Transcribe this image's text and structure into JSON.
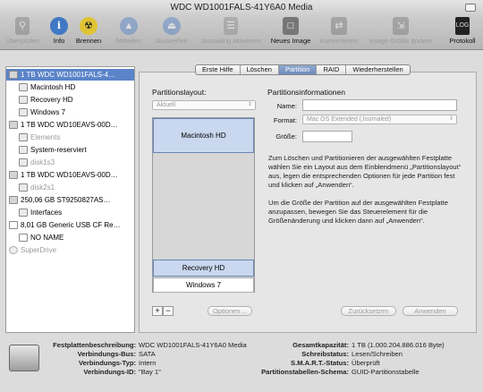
{
  "window": {
    "title": "WDC WD1001FALS-41Y6A0 Media"
  },
  "toolbar": {
    "items": [
      {
        "label": "Überprüfen",
        "icon": "microscope-icon",
        "enabled": false
      },
      {
        "label": "Info",
        "icon": "info-icon",
        "enabled": true
      },
      {
        "label": "Brennen",
        "icon": "burn-icon",
        "enabled": true
      },
      {
        "label": "Mitteilen",
        "icon": "mount-icon",
        "enabled": false
      },
      {
        "label": "Auswerfen",
        "icon": "eject-icon",
        "enabled": false
      },
      {
        "label": "Journaling aktivieren",
        "icon": "journal-icon",
        "enabled": false
      },
      {
        "label": "Neues Image",
        "icon": "new-image-icon",
        "enabled": true
      },
      {
        "label": "Konvertieren",
        "icon": "convert-icon",
        "enabled": false
      },
      {
        "label": "Image-Größe ändern",
        "icon": "resize-image-icon",
        "enabled": false
      },
      {
        "label": "Protokoll",
        "icon": "log-icon",
        "enabled": true
      }
    ]
  },
  "sidebar": {
    "items": [
      {
        "label": "1 TB WDC WD1001FALS-4…",
        "kind": "disk",
        "selected": true,
        "dimmed": false
      },
      {
        "label": "Macintosh HD",
        "kind": "volume",
        "selected": false,
        "dimmed": false
      },
      {
        "label": "Recovery HD",
        "kind": "volume",
        "selected": false,
        "dimmed": false
      },
      {
        "label": "Windows 7",
        "kind": "volume",
        "selected": false,
        "dimmed": false
      },
      {
        "label": "1 TB WDC WD10EAVS-00D…",
        "kind": "disk",
        "selected": false,
        "dimmed": false
      },
      {
        "label": "Elements",
        "kind": "volume",
        "selected": false,
        "dimmed": true
      },
      {
        "label": "System-reserviert",
        "kind": "volume",
        "selected": false,
        "dimmed": false
      },
      {
        "label": "disk1s3",
        "kind": "volume",
        "selected": false,
        "dimmed": true
      },
      {
        "label": "1 TB WDC WD10EAVS-00D…",
        "kind": "disk",
        "selected": false,
        "dimmed": false
      },
      {
        "label": "disk2s1",
        "kind": "volume",
        "selected": false,
        "dimmed": true
      },
      {
        "label": "250,06 GB ST9250827AS…",
        "kind": "disk",
        "selected": false,
        "dimmed": false
      },
      {
        "label": "Interfaces",
        "kind": "volume",
        "selected": false,
        "dimmed": false
      },
      {
        "label": "8,01 GB Generic USB CF Re…",
        "kind": "disk",
        "selected": false,
        "dimmed": false
      },
      {
        "label": "NO NAME",
        "kind": "volume",
        "selected": false,
        "dimmed": false
      },
      {
        "label": "SuperDrive",
        "kind": "optical",
        "selected": false,
        "dimmed": true
      }
    ]
  },
  "tabs": [
    {
      "label": "Erste Hilfe",
      "active": false
    },
    {
      "label": "Löschen",
      "active": false
    },
    {
      "label": "Partition",
      "active": true
    },
    {
      "label": "RAID",
      "active": false
    },
    {
      "label": "Wiederherstellen",
      "active": false
    }
  ],
  "partition": {
    "layout_title": "Partitionslayout:",
    "layout_popup": "Aktuell",
    "partitions": [
      "Macintosh HD",
      "Recovery HD",
      "Windows 7"
    ],
    "info_title": "Partitionsinformationen",
    "name_label": "Name:",
    "name_value": "",
    "format_label": "Format:",
    "format_value": "Mac OS Extended (Journaled)",
    "size_label": "Größe:",
    "size_value": "",
    "help1": "Zum Löschen und Partitionieren der ausgewählten Festplatte wählen Sie ein Layout aus dem Einblendmenü „Partitionslayout“ aus, legen die entsprechenden Optionen für jede Partition fest und klicken auf „Anwenden“.",
    "help2": "Um die Größe der Partition auf der ausgewählten Festplatte anzupassen, bewegen Sie das Steuerelement für die Größenänderung und klicken dann auf „Anwenden“.",
    "add_label": "+",
    "remove_label": "−",
    "options_label": "Optionen…",
    "revert_label": "Zurücksetzen",
    "apply_label": "Anwenden"
  },
  "details": {
    "left": [
      {
        "key": "Festplattenbeschreibung:",
        "value": "WDC WD1001FALS-41Y6A0 Media"
      },
      {
        "key": "Verbindungs-Bus:",
        "value": "SATA"
      },
      {
        "key": "Verbindungs-Typ:",
        "value": "Intern"
      },
      {
        "key": "Verbindungs-ID:",
        "value": "\"Bay 1\""
      }
    ],
    "right": [
      {
        "key": "Gesamtkapazität:",
        "value": "1 TB (1.000.204.886.016 Byte)"
      },
      {
        "key": "Schreibstatus:",
        "value": "Lesen/Schreiben"
      },
      {
        "key": "S.M.A.R.T.-Status:",
        "value": "Überprüft"
      },
      {
        "key": "Partitionstabellen-Schema:",
        "value": "GUID-Partitionstabelle"
      }
    ]
  },
  "colors": {
    "selection": "#5b84c9",
    "partition_fill": "#c9d8ee",
    "partition_border": "#6a85b5"
  }
}
